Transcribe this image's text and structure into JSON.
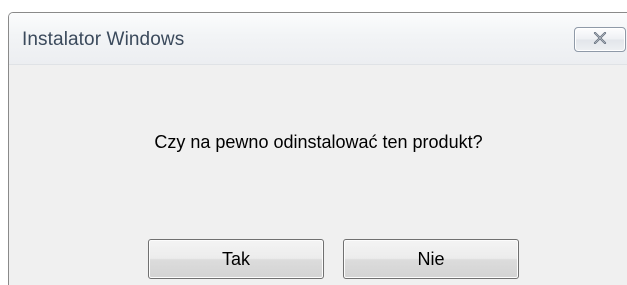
{
  "window": {
    "title": "Instalator Windows",
    "close_icon": "close-icon"
  },
  "dialog": {
    "message": "Czy na pewno odinstalować ten produkt?",
    "buttons": {
      "yes_label": "Tak",
      "no_label": "Nie"
    }
  },
  "colors": {
    "client_background": "#f0f0f0",
    "title_text": "#3b4a5c"
  }
}
